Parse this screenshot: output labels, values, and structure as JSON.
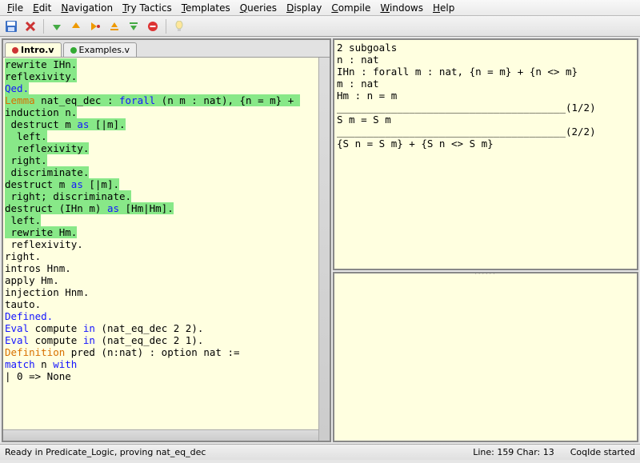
{
  "menus": [
    "File",
    "Edit",
    "Navigation",
    "Try Tactics",
    "Templates",
    "Queries",
    "Display",
    "Compile",
    "Windows",
    "Help"
  ],
  "toolbar_icons": [
    "save-icon",
    "close-icon",
    "down-arrow-icon",
    "up-arrow-icon",
    "goto-icon",
    "step-back-icon",
    "step-forward-icon",
    "stop-icon",
    "hint-icon"
  ],
  "tabs": [
    {
      "label": "Intro.v",
      "active": true,
      "dot": "red"
    },
    {
      "label": "Examples.v",
      "active": false,
      "dot": "green"
    }
  ],
  "editor_lines": [
    {
      "segs": [
        {
          "t": "rewrite IHn.",
          "hl": true
        }
      ]
    },
    {
      "segs": [
        {
          "t": "reflexivity.",
          "hl": true
        }
      ]
    },
    {
      "segs": [
        {
          "t": "Qed.",
          "hl": true,
          "cls": "kw-blue"
        }
      ]
    },
    {
      "segs": [
        {
          "t": ""
        }
      ]
    },
    {
      "segs": [
        {
          "t": "Lemma",
          "cls": "kw-lemma",
          "hl": true
        },
        {
          "t": " nat_eq_dec : ",
          "hl": true
        },
        {
          "t": "forall",
          "cls": "kw-blue",
          "hl": true
        },
        {
          "t": " (n m : nat), {n = m} + ",
          "hl": true
        }
      ]
    },
    {
      "segs": [
        {
          "t": "induction n.",
          "hl": true
        }
      ]
    },
    {
      "segs": [
        {
          "t": " destruct m ",
          "hl": true
        },
        {
          "t": "as",
          "cls": "kw-blue",
          "hl": true
        },
        {
          "t": " [|m].",
          "hl": true
        }
      ]
    },
    {
      "segs": [
        {
          "t": "  left.",
          "hl": true
        }
      ]
    },
    {
      "segs": [
        {
          "t": "  reflexivity.",
          "hl": true
        }
      ]
    },
    {
      "segs": [
        {
          "t": " right.",
          "hl": true
        }
      ]
    },
    {
      "segs": [
        {
          "t": " discriminate.",
          "hl": true
        }
      ]
    },
    {
      "segs": [
        {
          "t": "destruct m ",
          "hl": true
        },
        {
          "t": "as",
          "cls": "kw-blue",
          "hl": true
        },
        {
          "t": " [|m].",
          "hl": true
        }
      ]
    },
    {
      "segs": [
        {
          "t": " right; discriminate.",
          "hl": true
        }
      ]
    },
    {
      "segs": [
        {
          "t": "destruct (IHn m) ",
          "hl": true
        },
        {
          "t": "as",
          "cls": "kw-blue",
          "hl": true
        },
        {
          "t": " [Hm|Hm].",
          "hl": true
        }
      ]
    },
    {
      "segs": [
        {
          "t": " left.",
          "hl": true
        }
      ]
    },
    {
      "segs": [
        {
          "t": " rewrite Hm.",
          "hl": true
        }
      ]
    },
    {
      "segs": [
        {
          "t": " reflexivity."
        }
      ]
    },
    {
      "segs": [
        {
          "t": "right."
        }
      ]
    },
    {
      "segs": [
        {
          "t": "intros Hnm."
        }
      ]
    },
    {
      "segs": [
        {
          "t": "apply Hm."
        }
      ]
    },
    {
      "segs": [
        {
          "t": "injection Hnm."
        }
      ]
    },
    {
      "segs": [
        {
          "t": "tauto."
        }
      ]
    },
    {
      "segs": [
        {
          "t": "Defined.",
          "cls": "kw-blue"
        }
      ]
    },
    {
      "segs": [
        {
          "t": ""
        }
      ]
    },
    {
      "segs": [
        {
          "t": "Eval",
          "cls": "kw-blue"
        },
        {
          "t": " compute "
        },
        {
          "t": "in",
          "cls": "kw-blue"
        },
        {
          "t": " (nat_eq_dec 2 2)."
        }
      ]
    },
    {
      "segs": [
        {
          "t": "Eval",
          "cls": "kw-blue"
        },
        {
          "t": " compute "
        },
        {
          "t": "in",
          "cls": "kw-blue"
        },
        {
          "t": " (nat_eq_dec 2 1)."
        }
      ]
    },
    {
      "segs": [
        {
          "t": ""
        }
      ]
    },
    {
      "segs": [
        {
          "t": "Definition",
          "cls": "kw-def"
        },
        {
          "t": " pred (n:nat) : option nat :="
        }
      ]
    },
    {
      "segs": [
        {
          "t": "match",
          "cls": "kw-blue"
        },
        {
          "t": " n "
        },
        {
          "t": "with",
          "cls": "kw-blue"
        }
      ]
    },
    {
      "segs": [
        {
          "t": "| 0 => None"
        }
      ]
    }
  ],
  "goal_lines": [
    "2 subgoals",
    "n : nat",
    "IHn : forall m : nat, {n = m} + {n <> m}",
    "m : nat",
    "Hm : n = m",
    "______________________________________(1/2)",
    "S m = S m",
    "",
    "",
    "______________________________________(2/2)",
    "{S n = S m} + {S n <> S m}"
  ],
  "status": {
    "left": "Ready in Predicate_Logic, proving nat_eq_dec",
    "mid": "Line:  159 Char:  13",
    "right": "CoqIde started"
  }
}
